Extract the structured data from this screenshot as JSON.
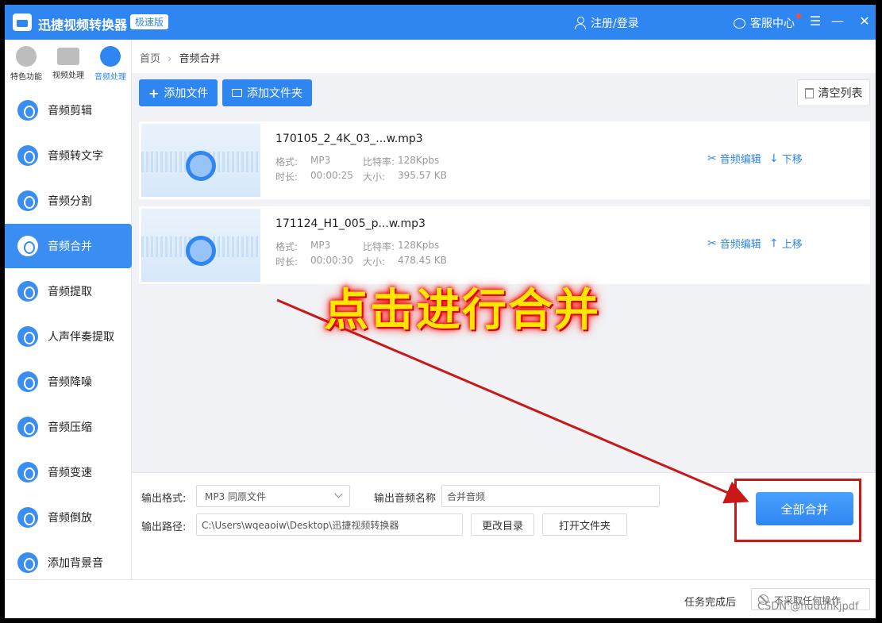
{
  "app": {
    "title": "迅捷视频转换器",
    "edition": "极速版"
  },
  "header": {
    "login_label": "注册/登录",
    "service_label": "客服中心"
  },
  "window_controls": {
    "menu": "☰",
    "minimize": "—",
    "close": "✕"
  },
  "categories": [
    {
      "label": "特色功能",
      "icon": "star-icon"
    },
    {
      "label": "视频处理",
      "icon": "film-icon"
    },
    {
      "label": "音频处理",
      "icon": "audio-icon",
      "active": true
    }
  ],
  "tools": [
    {
      "label": "音频剪辑"
    },
    {
      "label": "音频转文字"
    },
    {
      "label": "音频分割"
    },
    {
      "label": "音频合并",
      "active": true
    },
    {
      "label": "音频提取"
    },
    {
      "label": "人声伴奏提取"
    },
    {
      "label": "音频降噪"
    },
    {
      "label": "音频压缩"
    },
    {
      "label": "音频变速"
    },
    {
      "label": "音频倒放"
    },
    {
      "label": "添加背景音"
    }
  ],
  "breadcrumb": {
    "home": "首页",
    "separator": "›",
    "current": "音频合并"
  },
  "toolbar": {
    "add_file": "添加文件",
    "add_folder": "添加文件夹",
    "clear_list": "清空列表"
  },
  "files": [
    {
      "name": "170105_2_4K_03_...w.mp3",
      "format_label": "格式:",
      "format": "MP3",
      "bitrate_label": "比特率:",
      "bitrate": "128Kpbs",
      "duration_label": "时长:",
      "duration": "00:00:25",
      "size_label": "大小:",
      "size": "395.57 KB",
      "edit_label": "音频编辑",
      "move_label": "下移",
      "move_arrow": "↓"
    },
    {
      "name": "171124_H1_005_p...w.mp3",
      "format_label": "格式:",
      "format": "MP3",
      "bitrate_label": "比特率:",
      "bitrate": "128Kpbs",
      "duration_label": "时长:",
      "duration": "00:00:30",
      "size_label": "大小:",
      "size": "478.45 KB",
      "edit_label": "音频编辑",
      "move_label": "上移",
      "move_arrow": "↑"
    }
  ],
  "annotation": {
    "text": "点击进行合并",
    "color": "#c81818"
  },
  "output": {
    "format_label": "输出格式:",
    "format_value": "MP3  同原文件",
    "name_label": "输出音频名称",
    "name_value": "合并音频",
    "path_label": "输出路径:",
    "path_value": "C:\\Users\\wqeaoiw\\Desktop\\迅捷视频转换器",
    "change_dir": "更改目录",
    "open_folder": "打开文件夹",
    "merge_all": "全部合并"
  },
  "status": {
    "after_label": "任务完成后",
    "after_value": "不采取任何操作",
    "watermark": "CSDN @hudunkjpdf"
  },
  "colors": {
    "accent": "#2f86f0",
    "annotation_red": "#c81818",
    "annotation_yellow": "#ffe600"
  }
}
